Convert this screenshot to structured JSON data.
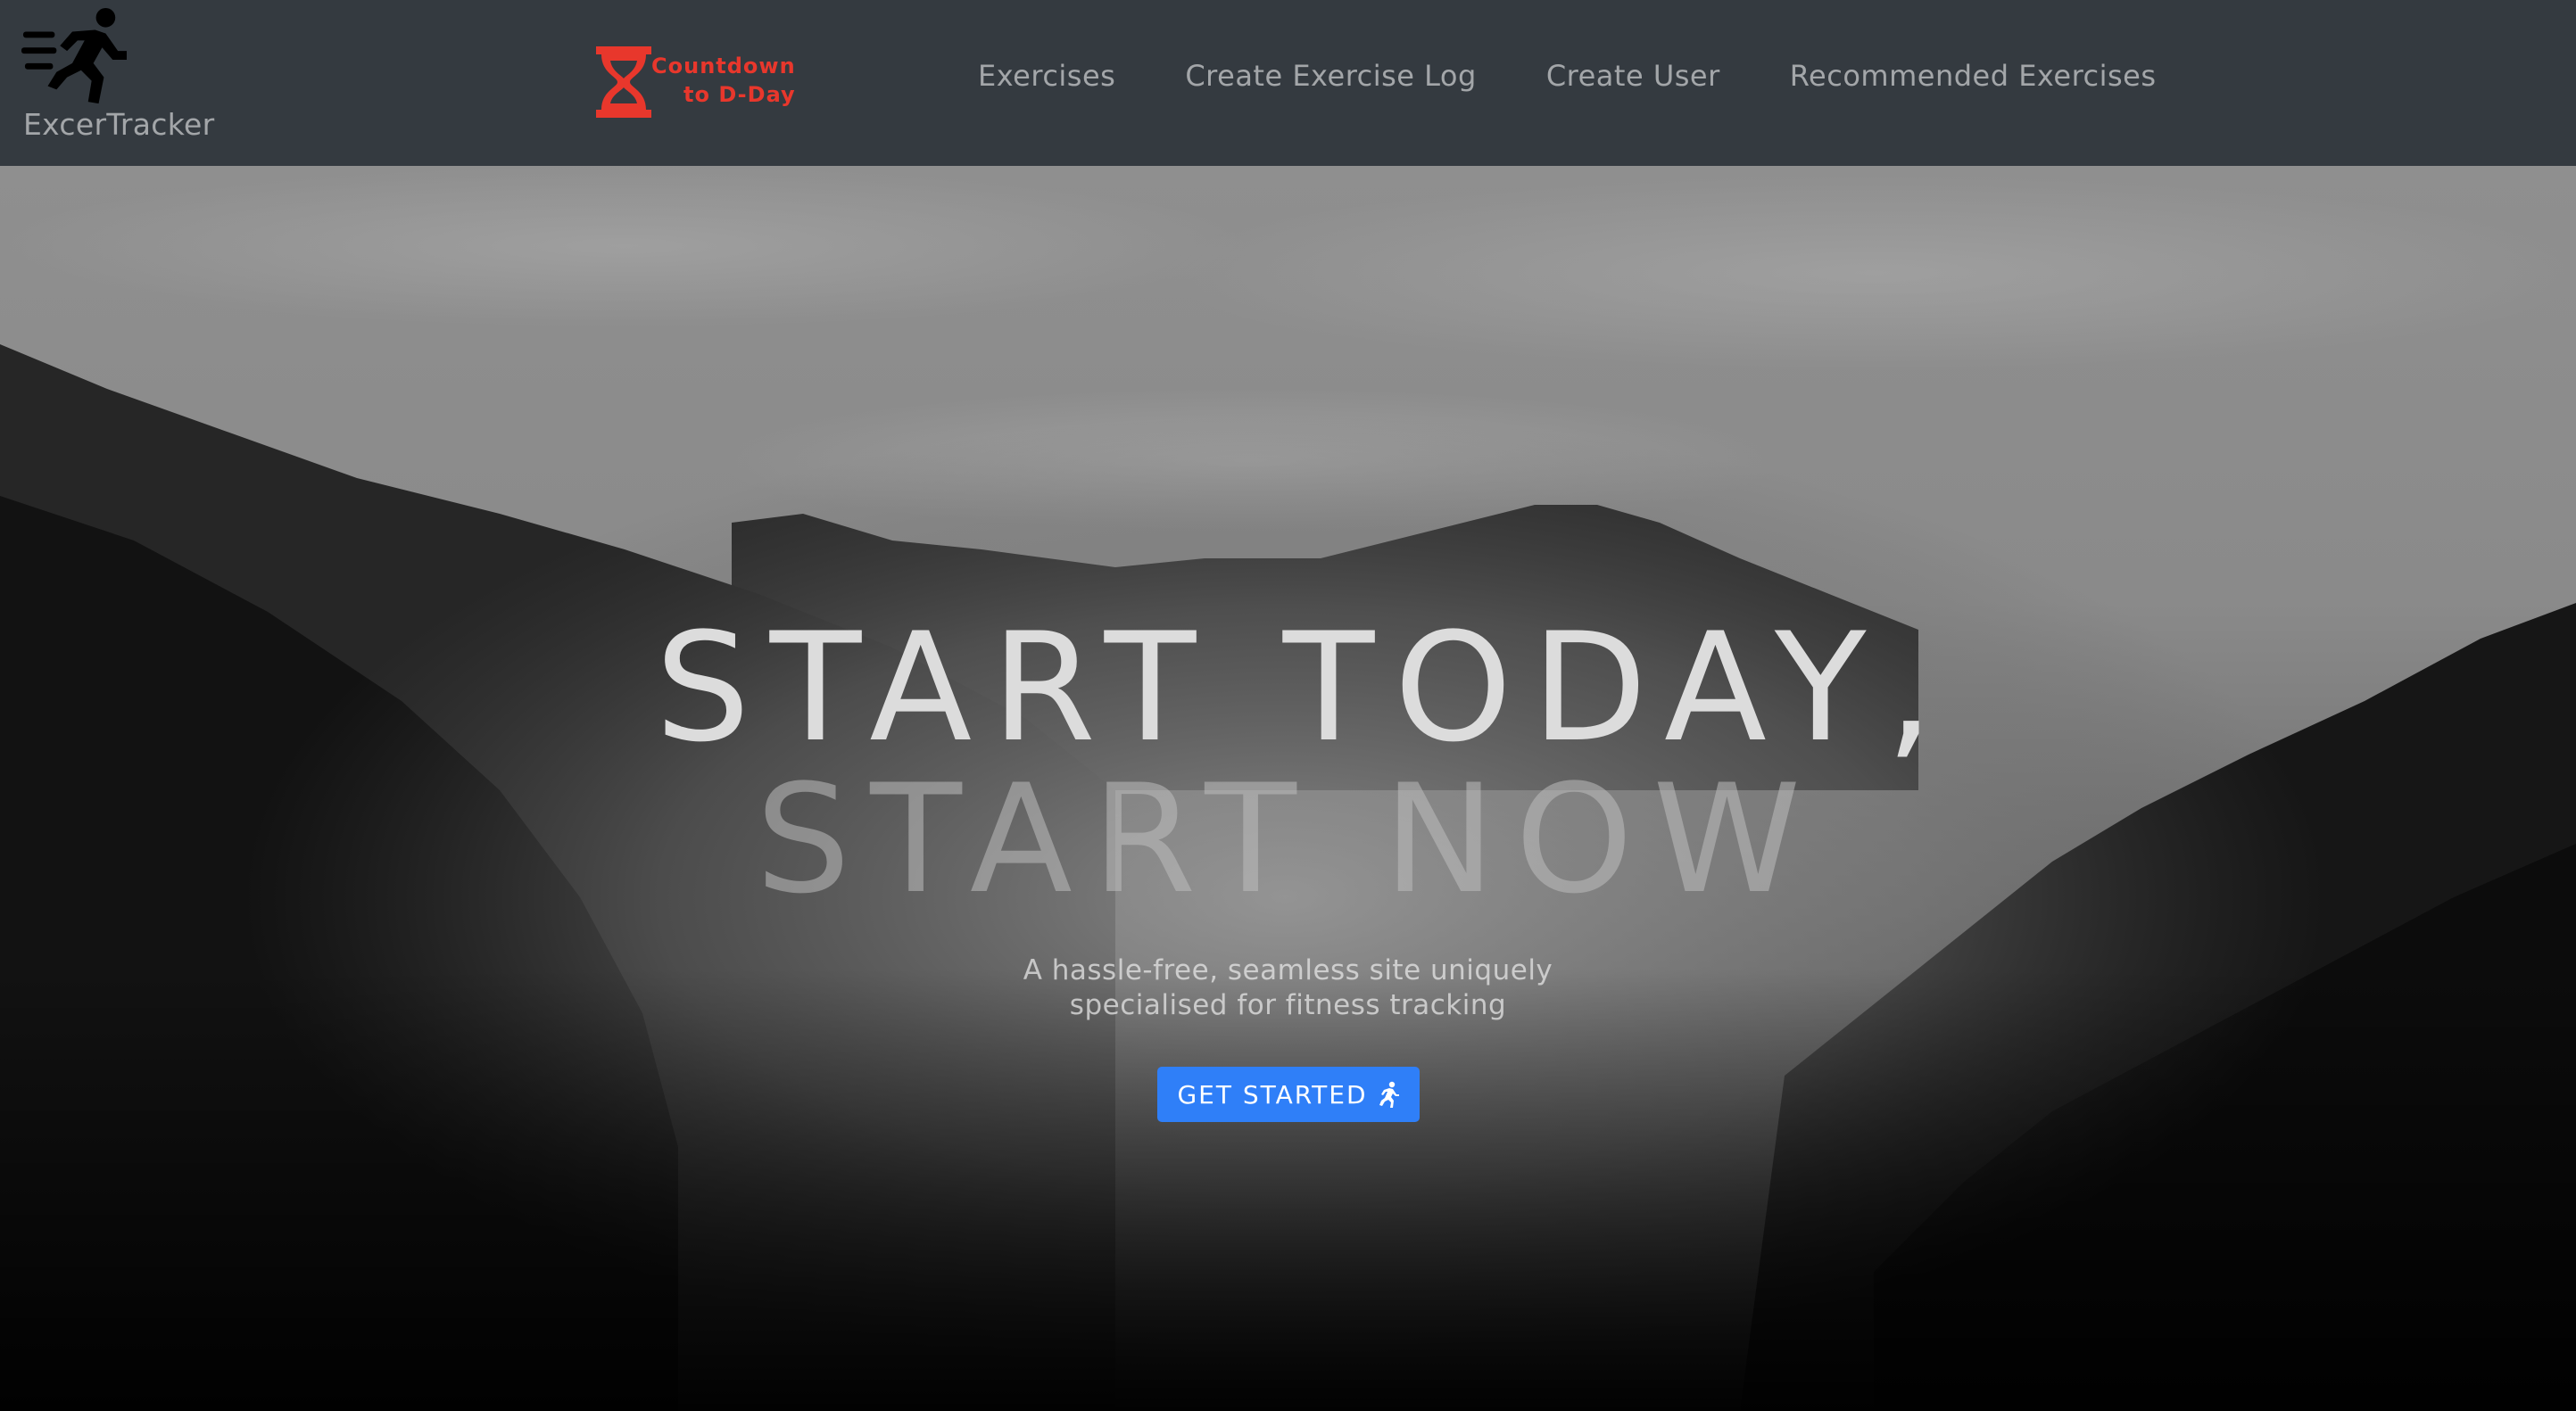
{
  "navbar": {
    "brand": {
      "icon": "running-man-icon",
      "label": "ExcerTracker"
    },
    "countdown": {
      "icon": "hourglass-icon",
      "line1": "Countdown",
      "line2": "to D-Day",
      "color": "#e8372c"
    },
    "links": [
      {
        "label": "Exercises"
      },
      {
        "label": "Create Exercise Log"
      },
      {
        "label": "Create User"
      },
      {
        "label": "Recommended Exercises"
      }
    ],
    "background": "#343a40"
  },
  "hero": {
    "background": "misty-mountain-forest-grayscale",
    "title_line_1": "START TODAY,",
    "title_line_2": "START NOW",
    "subtitle_line_1": "A hassle-free, seamless site uniquely",
    "subtitle_line_2": "specialised for fitness tracking",
    "cta": {
      "label": "GET STARTED",
      "icon": "running-man-icon",
      "color": "#2f7ff8"
    }
  }
}
